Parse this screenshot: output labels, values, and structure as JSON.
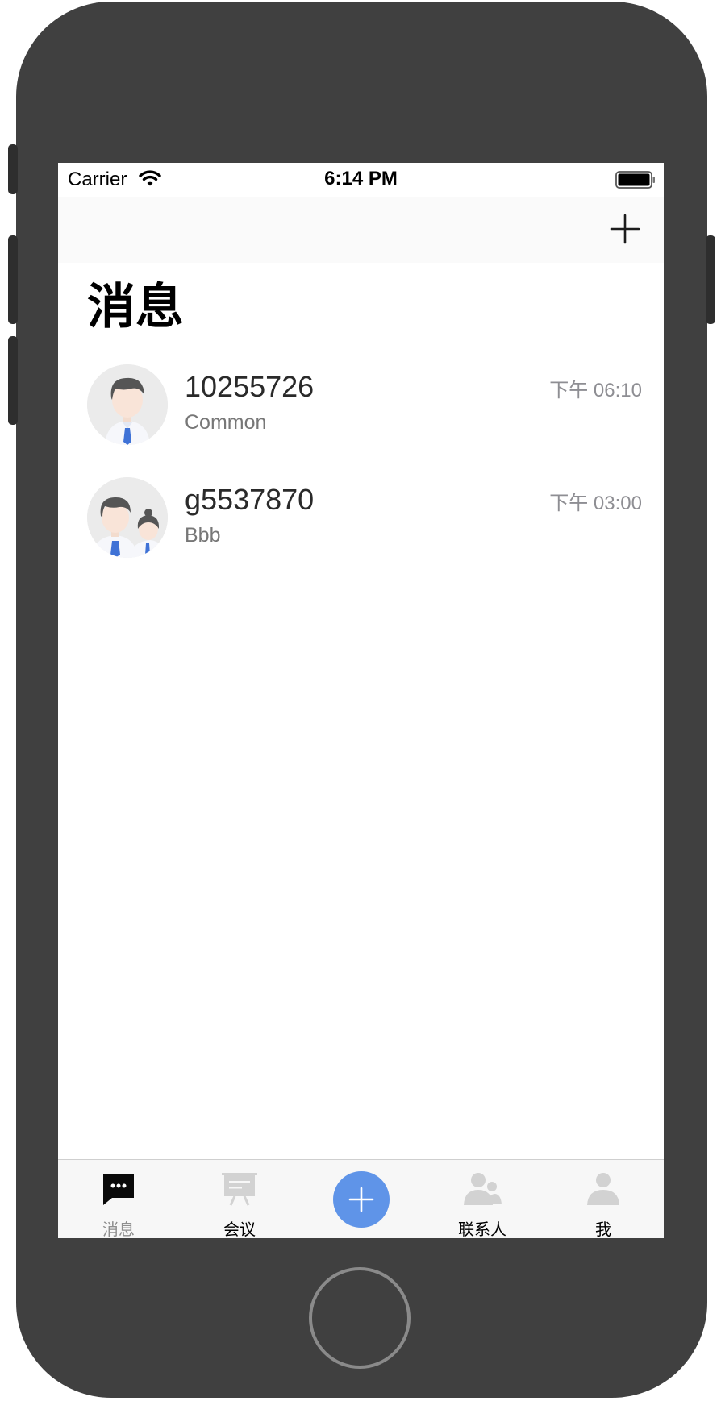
{
  "status_bar": {
    "carrier": "Carrier",
    "time": "6:14 PM"
  },
  "nav": {
    "title": "消息",
    "add_icon": "plus-icon"
  },
  "conversations": [
    {
      "name": "10255726",
      "preview": "Common",
      "time": "下午 06:10",
      "avatar": "single-user-avatar"
    },
    {
      "name": "g5537870",
      "preview": "Bbb",
      "time": "下午 03:00",
      "avatar": "group-avatar"
    }
  ],
  "tab_bar": {
    "tabs": [
      {
        "label": "消息",
        "icon": "chat-bubble-icon",
        "active": true
      },
      {
        "label": "会议",
        "icon": "meeting-board-icon",
        "active": false
      },
      {
        "label": "",
        "icon": "plus-icon",
        "active": false
      },
      {
        "label": "联系人",
        "icon": "contacts-icon",
        "active": false
      },
      {
        "label": "我",
        "icon": "person-icon",
        "active": false
      }
    ]
  },
  "colors": {
    "accent": "#5f94e8",
    "device_body": "#404040",
    "secondary_text": "#8e8e93"
  }
}
